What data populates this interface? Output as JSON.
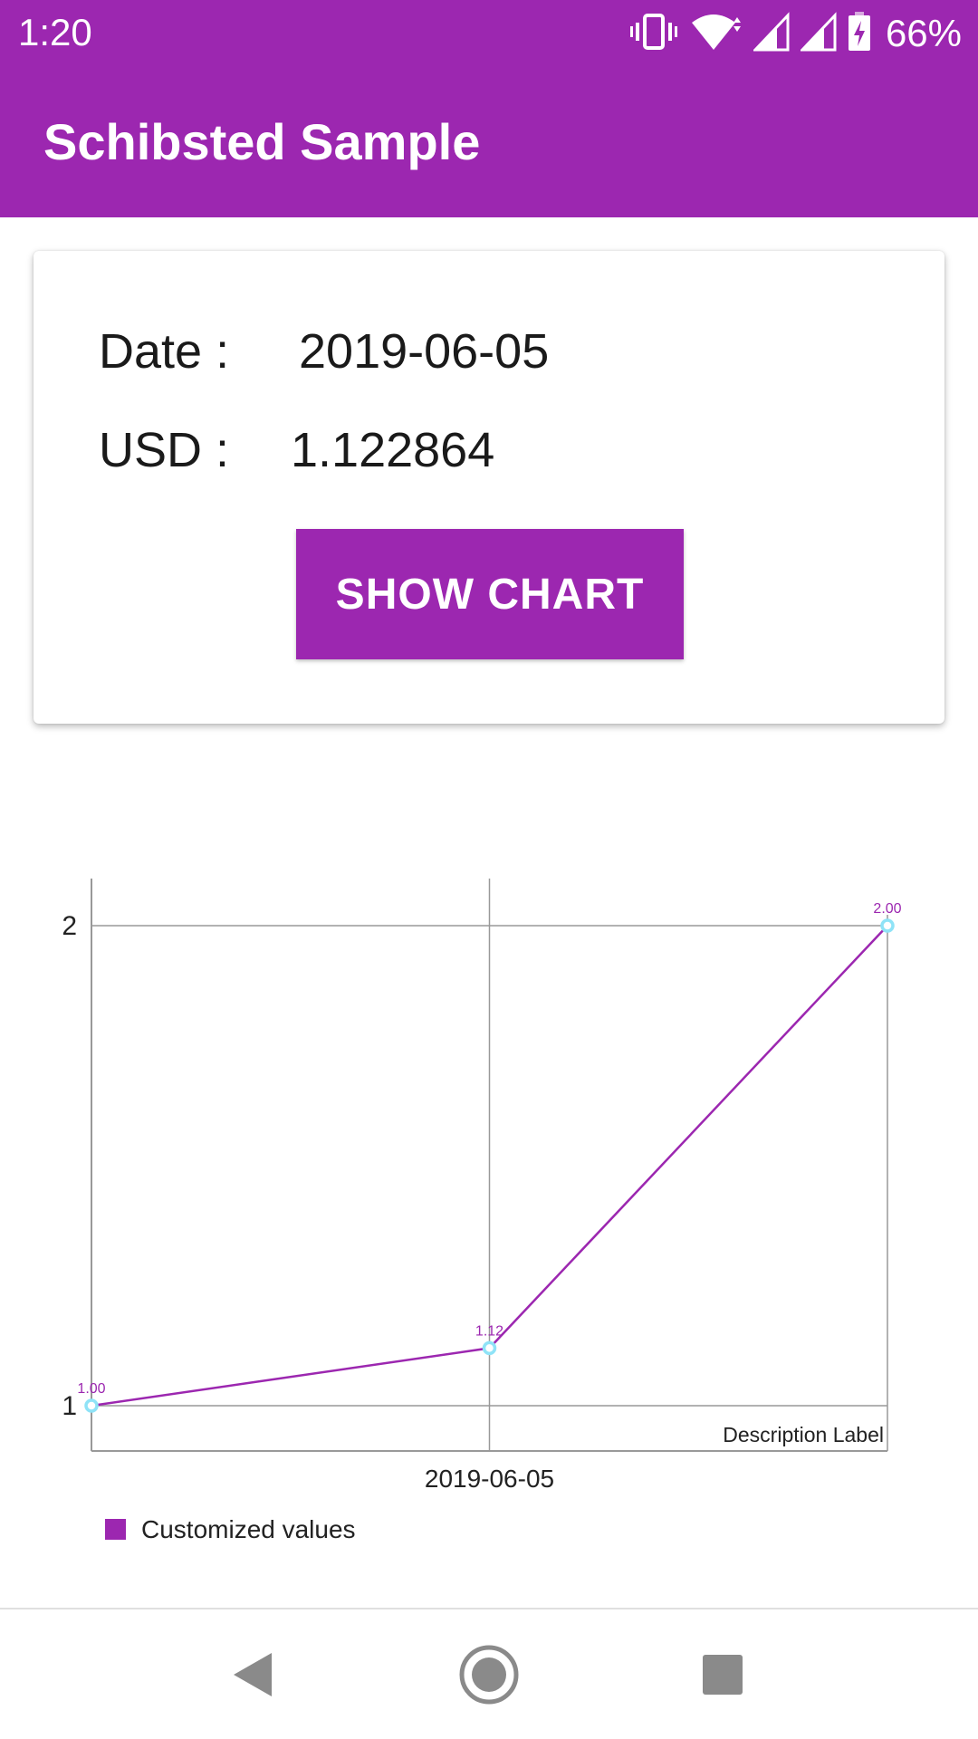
{
  "status_bar": {
    "time": "1:20",
    "battery_percent": "66%",
    "icons": [
      "vibrate-icon",
      "wifi-icon",
      "signal-icon",
      "signal-icon",
      "battery-charging-icon"
    ]
  },
  "app_bar": {
    "title": "Schibsted Sample"
  },
  "card": {
    "date_label": "Date :",
    "date_value": "2019-06-05",
    "usd_label": "USD :",
    "usd_value": "1.122864",
    "button_label": "SHOW CHART"
  },
  "colors": {
    "primary": "#9c27b0",
    "point_circle": "#8fe3f7",
    "grid": "#999999"
  },
  "chart_data": {
    "type": "line",
    "x_tick_labels": [
      "2019-06-05"
    ],
    "y_tick_labels": [
      "1",
      "2"
    ],
    "ylim": [
      1,
      2
    ],
    "description": "Description Label",
    "legend_position": "bottom-left",
    "grid": true,
    "series": [
      {
        "name": "Customized values",
        "values": [
          1.0,
          1.12,
          2.0
        ],
        "value_labels": [
          "1.00",
          "1.12",
          "2.00"
        ]
      }
    ]
  },
  "nav_bar": {
    "buttons": [
      "back-icon",
      "home-icon",
      "recents-icon"
    ]
  }
}
